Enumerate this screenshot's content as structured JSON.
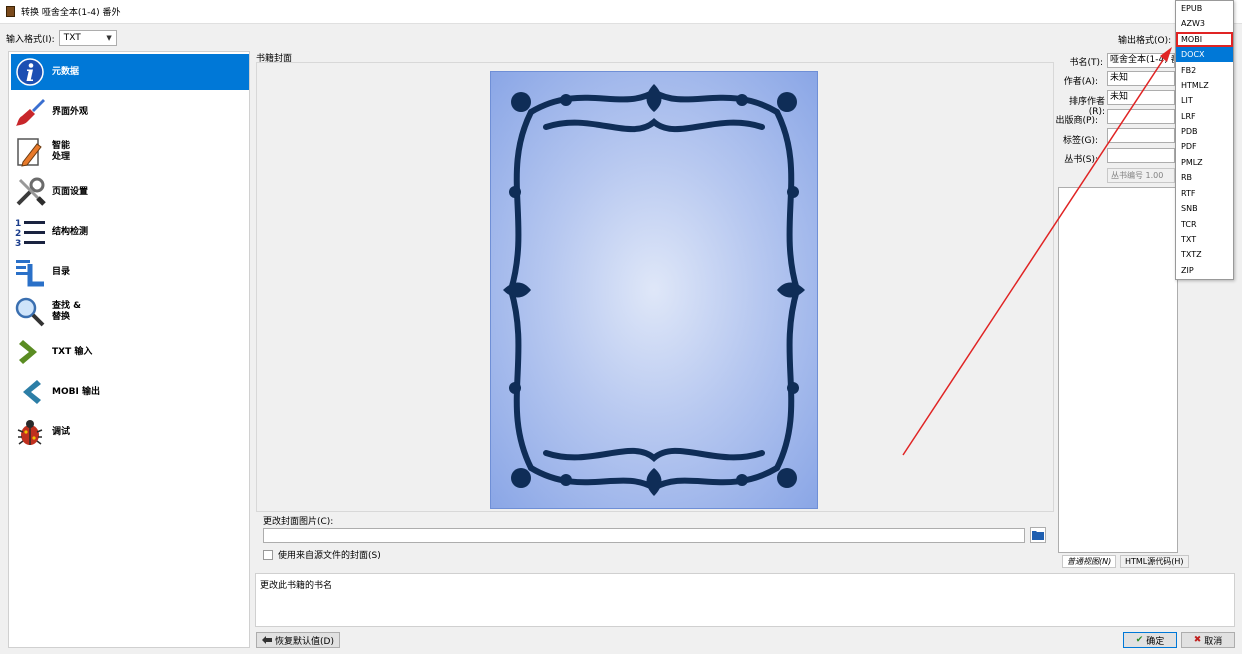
{
  "window": {
    "title": "转换 哑舍全本(1-4) 番外"
  },
  "input_format": {
    "label": "输入格式(I):",
    "value": "TXT"
  },
  "output_format": {
    "label": "输出格式(O):"
  },
  "sidebar": {
    "items": [
      {
        "label": "元数据",
        "icon": "info-icon"
      },
      {
        "label": "界面外观",
        "icon": "brush-icon"
      },
      {
        "label": "智能\n处理",
        "icon": "document-pencil-icon"
      },
      {
        "label": "页面设置",
        "icon": "tools-icon"
      },
      {
        "label": "结构检测",
        "icon": "numbered-list-icon"
      },
      {
        "label": "目录",
        "icon": "toc-icon"
      },
      {
        "label": "查找 &\n替换",
        "icon": "magnifier-icon"
      },
      {
        "label": "TXT 输入",
        "icon": "chevron-right-icon"
      },
      {
        "label": "MOBI 输出",
        "icon": "chevron-left-icon"
      },
      {
        "label": "调试",
        "icon": "bug-icon"
      }
    ]
  },
  "cover": {
    "section_label": "书籍封面",
    "change_label": "更改封面图片(C):",
    "path_value": "",
    "use_source_label": "使用来自源文件的封面(S)"
  },
  "metadata": {
    "title_label": "书名(T):",
    "title_value": "哑舍全本(1-4) 番外",
    "author_label": "作者(A):",
    "author_value": "未知",
    "sort_author_label": "排序作者(R):",
    "sort_author_value": "未知",
    "publisher_label": "出版商(P):",
    "publisher_value": "",
    "tags_label": "标签(G):",
    "tags_value": "",
    "series_label": "丛书(S):",
    "series_value": "",
    "series_number": "丛书编号 1.00",
    "tab_normal": "普通视图(N)",
    "tab_html": "HTML源代码(H)"
  },
  "description": {
    "text": "更改此书籍的书名"
  },
  "buttons": {
    "restore": "恢复默认值(D)",
    "ok": "确定",
    "cancel": "取消"
  },
  "format_dropdown": {
    "items": [
      "EPUB",
      "AZW3",
      "MOBI",
      "DOCX",
      "FB2",
      "HTMLZ",
      "LIT",
      "LRF",
      "PDB",
      "PDF",
      "PMLZ",
      "RB",
      "RTF",
      "SNB",
      "TCR",
      "TXT",
      "TXTZ",
      "ZIP"
    ],
    "selected": "DOCX",
    "highlighted": "MOBI"
  },
  "colors": {
    "accent": "#0078d7",
    "annotation": "#e02424",
    "cover_ornament": "#0f2d57"
  }
}
